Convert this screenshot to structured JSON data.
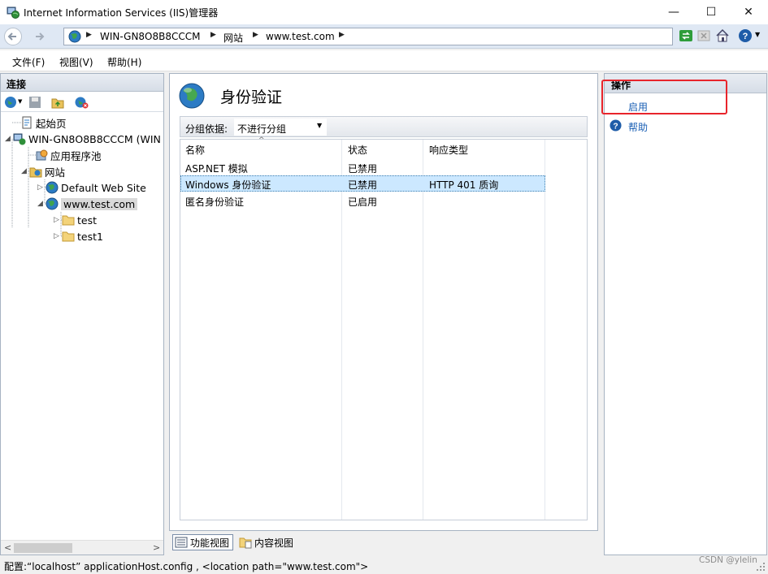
{
  "window": {
    "title": "Internet Information Services (IIS)管理器",
    "controls": {
      "minimize": "—",
      "maximize": "☐",
      "close": "✕"
    }
  },
  "address": {
    "crumbs": [
      "WIN-GN8O8B8CCCM",
      "网站",
      "www.test.com"
    ]
  },
  "menu": {
    "items": [
      "文件(F)",
      "视图(V)",
      "帮助(H)"
    ]
  },
  "connections": {
    "header": "连接",
    "tree": [
      {
        "label": "起始页",
        "level": 0
      },
      {
        "label": "WIN-GN8O8B8CCCM (WIN",
        "level": 0
      },
      {
        "label": "应用程序池",
        "level": 1
      },
      {
        "label": "网站",
        "level": 1
      },
      {
        "label": "Default Web Site",
        "level": 2
      },
      {
        "label": "www.test.com",
        "level": 2,
        "selected": true
      },
      {
        "label": "test",
        "level": 3
      },
      {
        "label": "test1",
        "level": 3
      }
    ]
  },
  "feature": {
    "title": "身份验证",
    "group_label": "分组依据:",
    "group_value": "不进行分组",
    "columns": [
      "名称",
      "状态",
      "响应类型"
    ],
    "rows": [
      {
        "name": "ASP.NET 模拟",
        "status": "已禁用",
        "response": ""
      },
      {
        "name": "Windows 身份验证",
        "status": "已禁用",
        "response": "HTTP 401 质询",
        "selected": true
      },
      {
        "name": "匿名身份验证",
        "status": "已启用",
        "response": ""
      }
    ]
  },
  "view_tabs": {
    "features": "功能视图",
    "content": "内容视图"
  },
  "actions": {
    "header": "操作",
    "enable": "启用",
    "help": "帮助"
  },
  "status": {
    "text": "配置:“localhost” applicationHost.config , <location path=\"www.test.com\">",
    "watermark": "CSDN @ylelin"
  },
  "colors": {
    "selection": "#cce8ff",
    "link": "#1a5fb4",
    "highlight": "#e8242b"
  }
}
